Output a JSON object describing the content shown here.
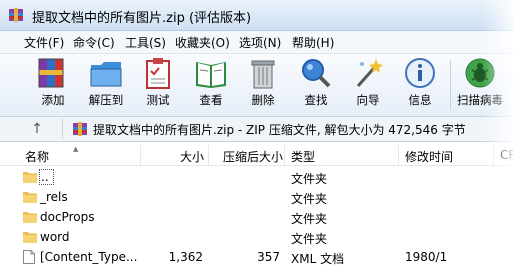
{
  "window": {
    "title": "提取文档中的所有图片.zip (评估版本)"
  },
  "menu": [
    "文件(F)",
    "命令(C)",
    "工具(S)",
    "收藏夹(O)",
    "选项(N)",
    "帮助(H)"
  ],
  "toolbar": {
    "add": "添加",
    "extract": "解压到",
    "test": "测试",
    "view": "查看",
    "delete": "删除",
    "find": "查找",
    "wizard": "向导",
    "info": "信息",
    "scan": "扫描病毒"
  },
  "address": {
    "text": "提取文档中的所有图片.zip - ZIP 压缩文件, 解包大小为 472,546 字节"
  },
  "columns": {
    "name": "名称",
    "size": "大小",
    "packed": "压缩后大小",
    "type": "类型",
    "modified": "修改时间",
    "crc": "CR"
  },
  "files": [
    {
      "name": "..",
      "size": "",
      "packed": "",
      "type": "文件夹",
      "modified": ""
    },
    {
      "name": "_rels",
      "size": "",
      "packed": "",
      "type": "文件夹",
      "modified": ""
    },
    {
      "name": "docProps",
      "size": "",
      "packed": "",
      "type": "文件夹",
      "modified": ""
    },
    {
      "name": "word",
      "size": "",
      "packed": "",
      "type": "文件夹",
      "modified": ""
    },
    {
      "name": "[Content_Type...",
      "size": "1,362",
      "packed": "357",
      "type": "XML 文档",
      "modified": "1980/1"
    }
  ]
}
